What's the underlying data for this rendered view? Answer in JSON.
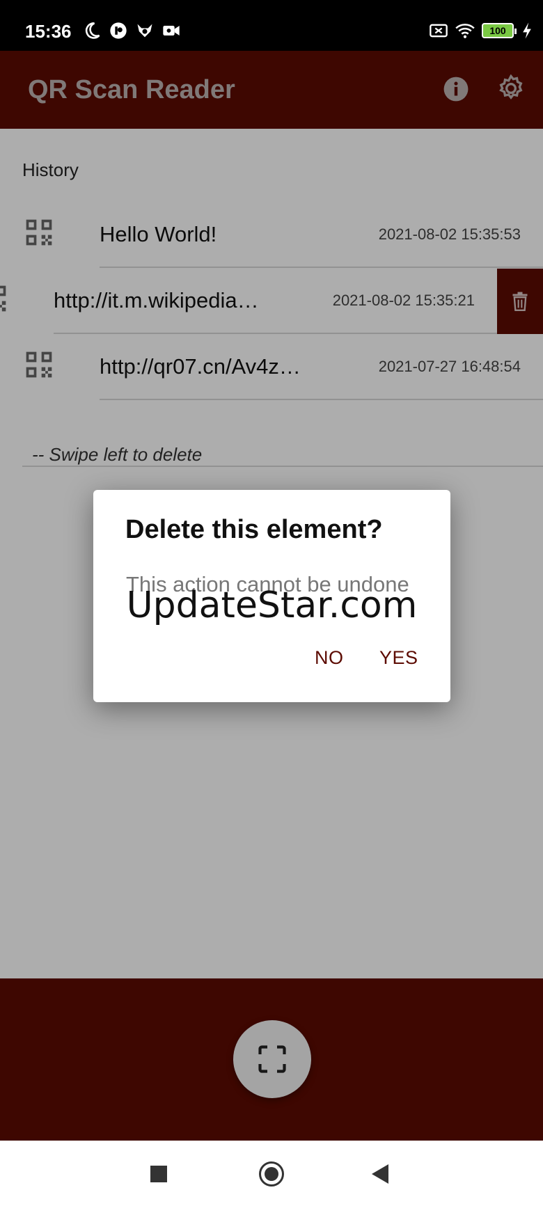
{
  "status_bar": {
    "time": "15:36",
    "battery_level": "100",
    "icons_left": [
      "moon-icon",
      "app-icon",
      "fox-icon",
      "video-icon"
    ],
    "icons_right": [
      "sim-off-icon",
      "wifi-icon",
      "battery-icon",
      "charging-icon"
    ]
  },
  "app_bar": {
    "title": "QR Scan Reader",
    "background_color": "#5c0b02",
    "actions": [
      "info-icon",
      "settings-gear-icon"
    ]
  },
  "history": {
    "label": "History",
    "items": [
      {
        "text": "Hello World!",
        "date": "2021-08-02 15:35:53"
      },
      {
        "text": "http://it.m.wikipedia…",
        "date": "2021-08-02 15:35:21",
        "swiped": true
      },
      {
        "text": "http://qr07.cn/Av4z…",
        "date": "2021-07-27 16:48:54"
      }
    ],
    "hint": "-- Swipe left to delete"
  },
  "dialog": {
    "title": "Delete this element?",
    "message": "This action cannot be undone",
    "watermark": "UpdateStar.com",
    "no_label": "NO",
    "yes_label": "YES"
  },
  "fab": {
    "icon": "scan-frame-icon"
  },
  "nav_bar": {
    "buttons": [
      "recents-button",
      "home-button",
      "back-button"
    ]
  }
}
